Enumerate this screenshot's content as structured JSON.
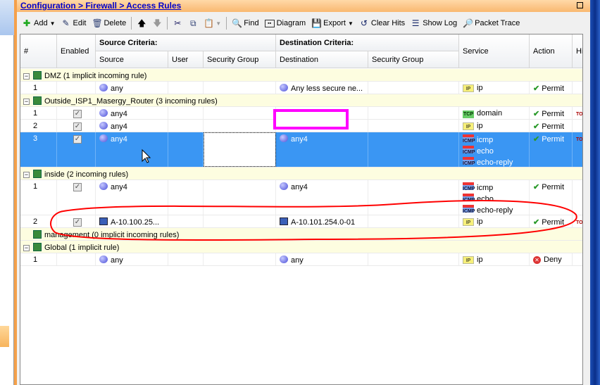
{
  "breadcrumb": "Configuration > Firewall > Access Rules",
  "toolbar": {
    "add": "Add",
    "edit": "Edit",
    "delete": "Delete",
    "find": "Find",
    "diagram": "Diagram",
    "export": "Export",
    "clear_hits": "Clear Hits",
    "show_log": "Show Log",
    "packet_trace": "Packet Trace"
  },
  "columns": {
    "num": "#",
    "enabled": "Enabled",
    "source_criteria": "Source Criteria:",
    "source": "Source",
    "user": "User",
    "src_security_group": "Security Group",
    "destination_criteria": "Destination Criteria:",
    "destination": "Destination",
    "dst_security_group": "Security Group",
    "service": "Service",
    "action": "Action",
    "hits": "Hits"
  },
  "rows": [
    {
      "type": "group",
      "label": "DMZ (1 implicit incoming rule)",
      "expanded": true
    },
    {
      "type": "rule",
      "num": "1",
      "enabled": null,
      "source": "any",
      "source_icon": "network",
      "destination": "Any less secure ne...",
      "dest_icon": "network",
      "services": [
        {
          "icon": "ip",
          "name": "ip"
        }
      ],
      "action": "Permit"
    },
    {
      "type": "group",
      "label": "Outside_ISP1_Masergy_Router (3 incoming rules)",
      "expanded": true
    },
    {
      "type": "rule",
      "num": "1",
      "enabled": true,
      "source": "any4",
      "source_icon": "network",
      "destination": "",
      "services": [
        {
          "icon": "tcp-udp",
          "name": "domain"
        }
      ],
      "action": "Permit",
      "hits": true
    },
    {
      "type": "rule",
      "num": "2",
      "enabled": true,
      "source": "any4",
      "source_icon": "network",
      "destination": "",
      "services": [
        {
          "icon": "ip",
          "name": "ip"
        }
      ],
      "action": "Permit"
    },
    {
      "type": "rule",
      "num": "3",
      "enabled": true,
      "selected": true,
      "source": "any4",
      "source_icon": "network",
      "destination": "any4",
      "dest_icon": "network",
      "services": [
        {
          "icon": "icmp",
          "name": "icmp"
        },
        {
          "icon": "icmp",
          "name": "echo"
        },
        {
          "icon": "icmp",
          "name": "echo-reply"
        }
      ],
      "action": "Permit",
      "hits": true
    },
    {
      "type": "group",
      "label": "inside (2 incoming rules)",
      "expanded": true
    },
    {
      "type": "rule",
      "num": "1",
      "enabled": true,
      "source": "any4",
      "source_icon": "network",
      "destination": "any4",
      "dest_icon": "network",
      "services": [
        {
          "icon": "icmp",
          "name": "icmp"
        },
        {
          "icon": "icmp",
          "name": "echo"
        },
        {
          "icon": "icmp",
          "name": "echo-reply"
        }
      ],
      "action": "Permit"
    },
    {
      "type": "rule",
      "num": "2",
      "enabled": true,
      "source": "A-10.100.25...",
      "source_icon": "host",
      "destination": "A-10.101.254.0-01",
      "dest_icon": "host",
      "services": [
        {
          "icon": "ip",
          "name": "ip"
        }
      ],
      "action": "Permit",
      "hits": true
    },
    {
      "type": "group",
      "label": "management (0 implicit incoming rules)",
      "expanded": false
    },
    {
      "type": "group",
      "label": "Global (1 implicit rule)",
      "expanded": true
    },
    {
      "type": "rule",
      "num": "1",
      "enabled": null,
      "source": "any",
      "source_icon": "network",
      "destination": "any",
      "dest_icon": "network",
      "services": [
        {
          "icon": "ip",
          "name": "ip"
        }
      ],
      "action": "Deny"
    }
  ],
  "colors": {
    "selection": "#3a96f3",
    "header_orange": "#f9b870",
    "annotation_red": "#ff0000",
    "annotation_magenta": "#ff00ff"
  }
}
